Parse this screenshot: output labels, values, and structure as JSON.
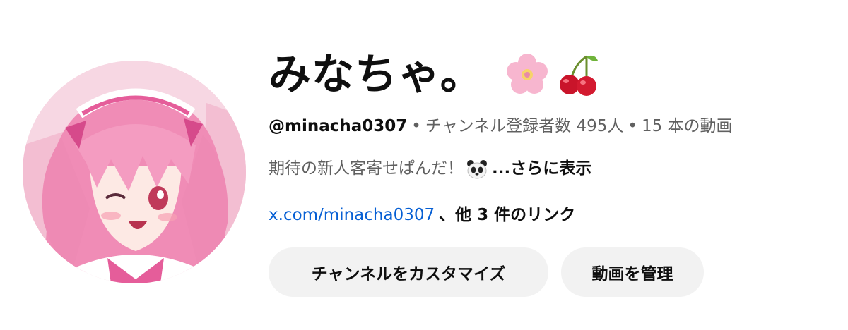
{
  "channel": {
    "name": "みなちゃ。",
    "emojis": [
      "cherry-blossom-icon",
      "cherries-icon"
    ],
    "handle": "@minacha0307",
    "separator": "•",
    "subscribers": "チャンネル登録者数 495人",
    "videos": "15 本の動画",
    "description": "期待の新人客寄せぱんだ！",
    "description_icon": "panda-icon",
    "more_label": "...さらに表示",
    "link": "x.com/minacha0307",
    "other_links": "、他 3 件のリンク"
  },
  "buttons": {
    "customize": "チャンネルをカスタマイズ",
    "manage": "動画を管理"
  },
  "colors": {
    "link": "#065fd4",
    "secondary_text": "#606060",
    "button_bg": "#f2f2f2",
    "avatar_pink": "#f4a3c4"
  }
}
